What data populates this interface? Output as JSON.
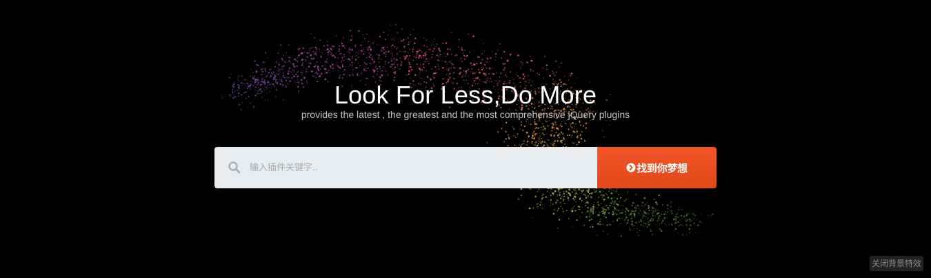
{
  "hero": {
    "title": "Look For Less,Do More",
    "subtitle": "provides the latest , the greatest and the most comprehensive jQuery plugins"
  },
  "search": {
    "placeholder": "输入插件关键字..",
    "value": "",
    "button_label": "找到你梦想",
    "icons": {
      "field": "search-icon",
      "button": "chevron-right-circle-icon"
    }
  },
  "footer": {
    "toggle_background_label": "关闭背景特效"
  },
  "colors": {
    "background": "#000000",
    "search_field": "#e9edf0",
    "accent": "#e8501f",
    "title": "#ffffff",
    "subtitle": "#c4c4c4"
  }
}
